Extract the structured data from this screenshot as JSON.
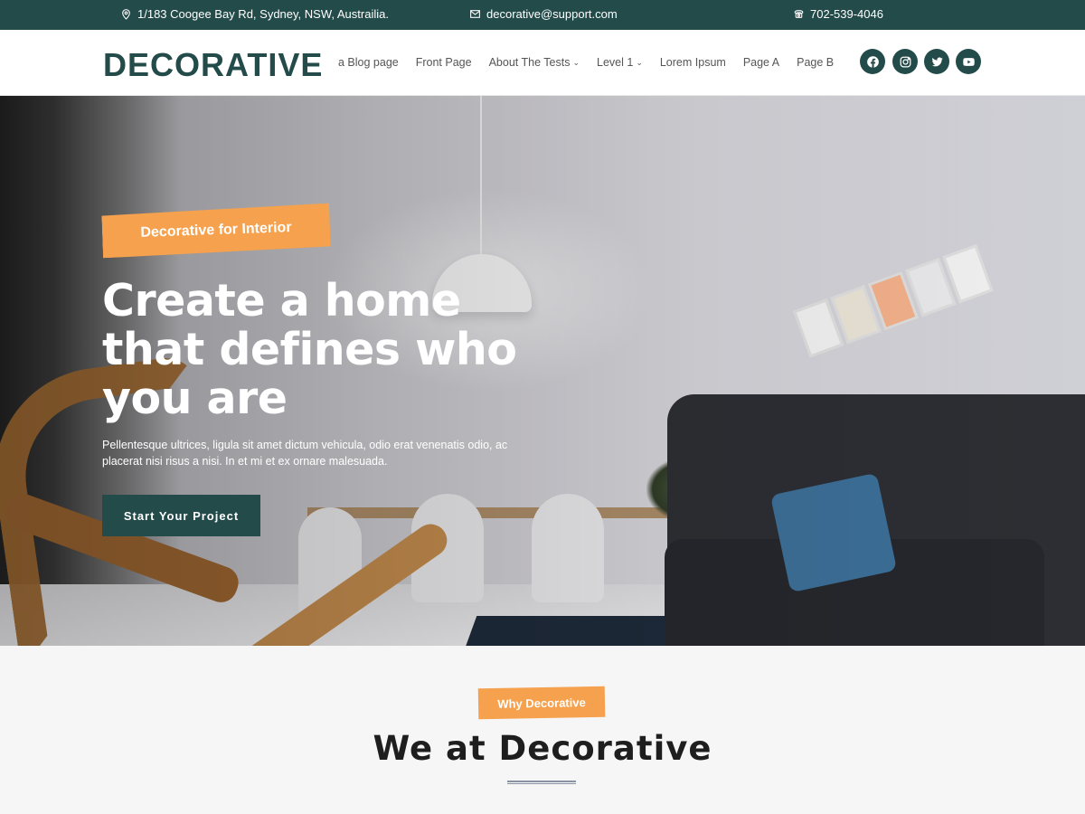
{
  "topbar": {
    "address": "1/183 Coogee Bay Rd, Sydney, NSW, Austrailia.",
    "email": "decorative@support.com",
    "phone": "702-539-4046"
  },
  "header": {
    "logo": "DECORATIVE",
    "nav": [
      {
        "label": "a Blog page",
        "dropdown": false
      },
      {
        "label": "Front Page",
        "dropdown": false
      },
      {
        "label": "About The Tests",
        "dropdown": true
      },
      {
        "label": "Level 1",
        "dropdown": true
      },
      {
        "label": "Lorem Ipsum",
        "dropdown": false
      },
      {
        "label": "Page A",
        "dropdown": false
      },
      {
        "label": "Page B",
        "dropdown": false
      }
    ],
    "socials": [
      "facebook-icon",
      "instagram-icon",
      "twitter-icon",
      "youtube-icon"
    ]
  },
  "hero": {
    "tag": "Decorative for Interior",
    "title": "Create a home that defines who you are",
    "text": "Pellentesque ultrices, ligula sit amet dictum vehicula, odio erat venenatis odio, ac placerat nisi risus a nisi. In et mi et ex ornare malesuada.",
    "cta": "Start Your Project"
  },
  "why": {
    "tag": "Why Decorative",
    "title": "We at Decorative"
  },
  "colors": {
    "primary": "#234b4a",
    "accent": "#f5a14e"
  }
}
